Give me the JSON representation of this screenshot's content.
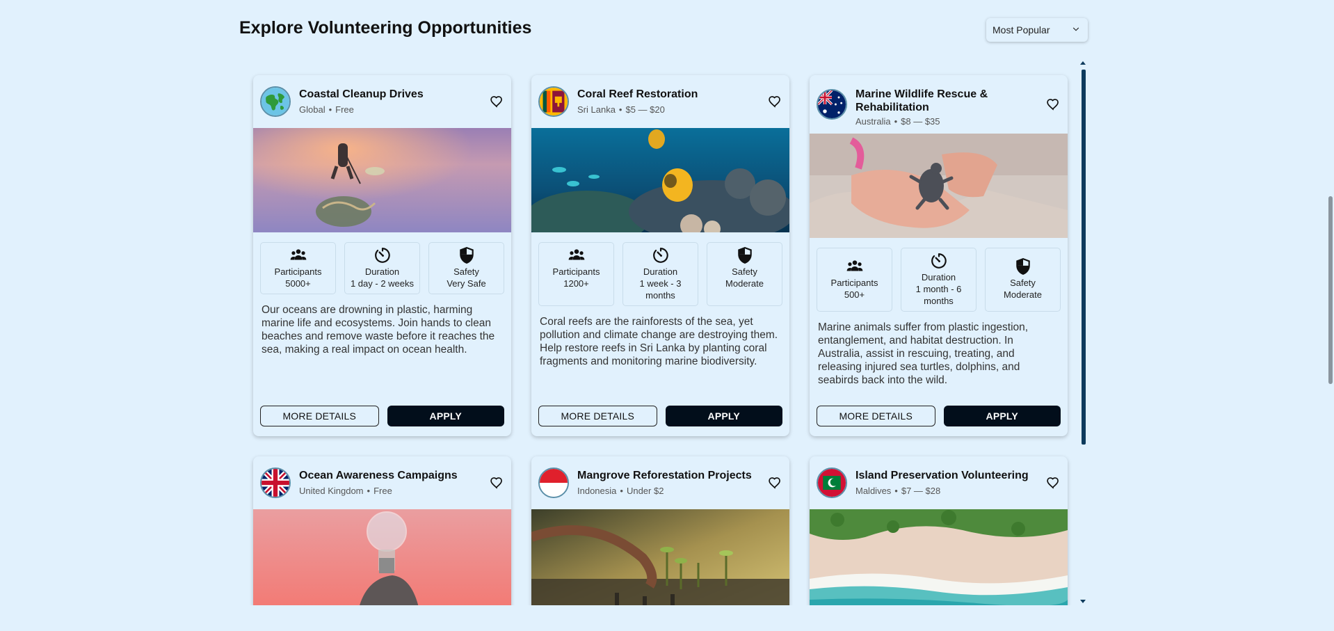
{
  "page": {
    "title": "Explore Volunteering Opportunities",
    "sort": {
      "selected": "Most Popular",
      "icon": "chevron-down-icon"
    }
  },
  "labels": {
    "participants": "Participants",
    "duration": "Duration",
    "safety": "Safety",
    "more_details": "MORE DETAILS",
    "apply": "APPLY",
    "separator": "•"
  },
  "cards": [
    {
      "title": "Coastal Cleanup Drives",
      "location": "Global",
      "price": "Free",
      "flag_icon": "globe-icon",
      "image": "beach-cleanup-photo",
      "participants": "5000+",
      "duration": "1 day - 2 weeks",
      "safety": "Very Safe",
      "description": "Our oceans are drowning in plastic, harming marine life and ecosystems. Join hands to clean beaches and remove waste before it reaches the sea, making a real impact on ocean health."
    },
    {
      "title": "Coral Reef Restoration",
      "location": "Sri Lanka",
      "price": "$5 — $20",
      "flag_icon": "sri-lanka-flag-icon",
      "image": "coral-reef-photo",
      "participants": "1200+",
      "duration": "1 week - 3 months",
      "safety": "Moderate",
      "description": "Coral reefs are the rainforests of the sea, yet pollution and climate change are destroying them. Help restore reefs in Sri Lanka by planting coral fragments and monitoring marine biodiversity."
    },
    {
      "title": "Marine Wildlife Rescue & Rehabilitation",
      "location": "Australia",
      "price": "$8 — $35",
      "flag_icon": "australia-flag-icon",
      "image": "baby-turtle-photo",
      "participants": "500+",
      "duration": "1 month - 6 months",
      "safety": "Moderate",
      "description": "Marine animals suffer from plastic ingestion, entanglement, and habitat destruction. In Australia, assist in rescuing, treating, and releasing injured sea turtles, dolphins, and seabirds back into the wild."
    },
    {
      "title": "Ocean Awareness Campaigns",
      "location": "United Kingdom",
      "price": "Free",
      "flag_icon": "uk-flag-icon",
      "image": "lightbulb-photo"
    },
    {
      "title": "Mangrove Reforestation Projects",
      "location": "Indonesia",
      "price": "Under $2",
      "flag_icon": "indonesia-flag-icon",
      "image": "mangrove-planting-photo"
    },
    {
      "title": "Island Preservation Volunteering",
      "location": "Maldives",
      "price": "$7 — $28",
      "flag_icon": "maldives-flag-icon",
      "image": "island-beach-photo"
    }
  ],
  "colors": {
    "background": "#e1f1fd",
    "apply_button": "#020e1b",
    "scroll_thumb": "#0d3a5c"
  }
}
